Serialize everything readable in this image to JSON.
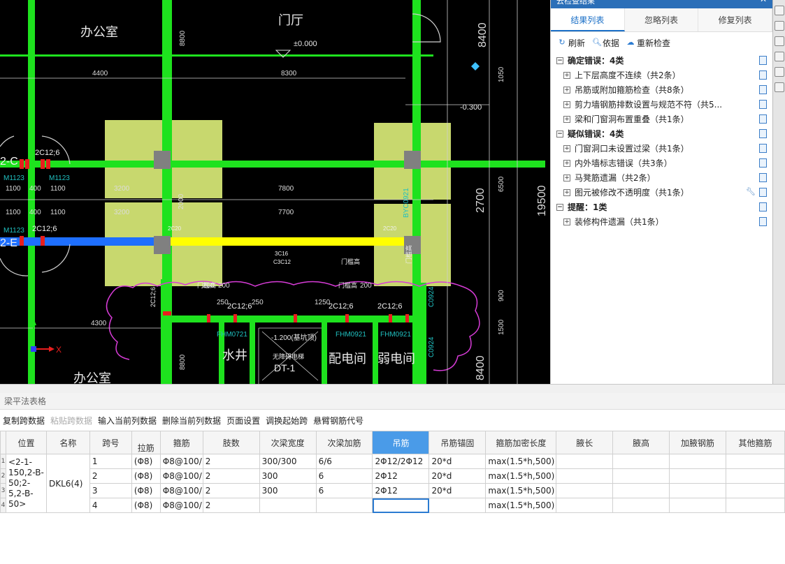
{
  "cad": {
    "rooms": [
      "办公室",
      "门厅",
      "办公室",
      "水井",
      "配电间",
      "弱电间"
    ],
    "elevations": [
      "±0.000",
      "-0.300",
      "-1.200(基坑顶)"
    ],
    "dims": [
      "4400",
      "8300",
      "8400",
      "1050",
      "3200",
      "7800",
      "3200",
      "7700",
      "2700",
      "6500",
      "19500",
      "1100",
      "400",
      "1100",
      "1100",
      "400",
      "1100",
      "4300",
      "8400",
      "8800",
      "2000",
      "200",
      "200",
      "200",
      "1250",
      "250",
      "250",
      "900",
      "1500",
      "8800"
    ],
    "beam_labels": [
      "2C12;6",
      "2C12;6",
      "2C12;6",
      "2C12;6",
      "2C12;6",
      "2C12;6",
      "2C20",
      "2C20",
      "3C16",
      "C3C12"
    ],
    "door_labels": [
      "M1123",
      "M1123",
      "M1123",
      "FHM0721",
      "FHM0921",
      "FHM0921",
      "C0924",
      "C0924",
      "BYC0921",
      "DT-1",
      "无障碍电梯",
      "门槛高",
      "门槛高",
      "门槛高",
      "门槛高"
    ],
    "axis_labels": [
      "2-C",
      "2-E"
    ],
    "axis_xy": [
      "Y",
      "X"
    ]
  },
  "panel": {
    "title": "云检查结果",
    "tabs": [
      "结果列表",
      "忽略列表",
      "修复列表"
    ],
    "tools": [
      "刷新",
      "依据",
      "重新检查"
    ],
    "groups": [
      {
        "label": "确定错误：4类",
        "items": [
          "上下层高度不连续（共2条）",
          "吊筋或附加箍筋检查（共8条）",
          "剪力墙钢筋排数设置与规范不符（共5...",
          "梁和门窗洞布置重叠（共1条）"
        ]
      },
      {
        "label": "疑似错误：4类",
        "items": [
          "门窗洞口未设置过梁（共1条）",
          "内外墙标志错误（共3条）",
          "马凳筋遗漏（共2条）",
          "图元被修改不透明度（共1条）"
        ]
      },
      {
        "label": "提醒：1类",
        "items": [
          "装修构件遗漏（共1条）"
        ]
      }
    ]
  },
  "grid_title": "梁平法表格",
  "toolbar": [
    "复制跨数据",
    "粘贴跨数据",
    "输入当前列数据",
    "删除当前列数据",
    "页面设置",
    "调换起始跨",
    "悬臂钢筋代号"
  ],
  "table": {
    "headers": [
      "位置",
      "名称",
      "跨号",
      "拉筋",
      "箍筋",
      "肢数",
      "次梁宽度",
      "次梁加筋",
      "吊筋",
      "吊筋锚固",
      "箍筋加密长度",
      "腋长",
      "腋高",
      "加腋钢筋",
      "其他箍筋"
    ],
    "position": "<2-1-150,2-B-50;2-5,2-B-50>",
    "name": "DKL6(4)",
    "row_numbers": [
      "1",
      "2",
      "3",
      "4"
    ],
    "rows": [
      [
        "1",
        "(Φ8)",
        "Φ8@100/",
        "2",
        "300/300",
        "6/6",
        "2Φ12/2Φ12",
        "20*d",
        "max(1.5*h,500)",
        "",
        "",
        "",
        ""
      ],
      [
        "2",
        "(Φ8)",
        "Φ8@100/",
        "2",
        "300",
        "6",
        "2Φ12",
        "20*d",
        "max(1.5*h,500)",
        "",
        "",
        "",
        ""
      ],
      [
        "3",
        "(Φ8)",
        "Φ8@100/",
        "2",
        "300",
        "6",
        "2Φ12",
        "20*d",
        "max(1.5*h,500)",
        "",
        "",
        "",
        ""
      ],
      [
        "4",
        "(Φ8)",
        "Φ8@100/",
        "2",
        "",
        "",
        "",
        "",
        "max(1.5*h,500)",
        "",
        "",
        "",
        ""
      ]
    ]
  }
}
